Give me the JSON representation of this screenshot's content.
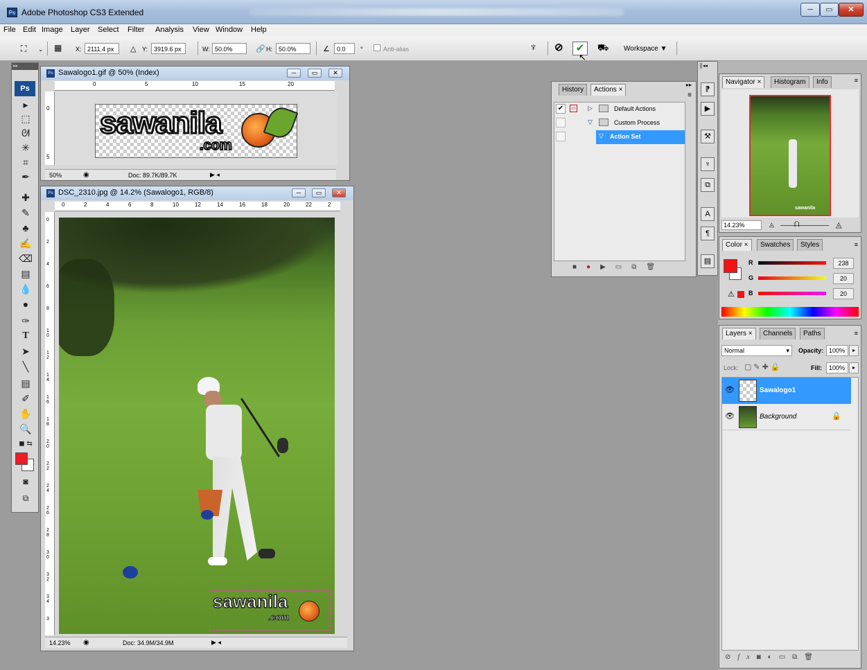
{
  "app": {
    "title": "Adobe Photoshop CS3 Extended",
    "icon_label": "Ps"
  },
  "menu": [
    "File",
    "Edit",
    "Image",
    "Layer",
    "Select",
    "Filter",
    "Analysis",
    "View",
    "Window",
    "Help"
  ],
  "options": {
    "x_label": "X:",
    "x_value": "2111.4 px",
    "y_label": "Y:",
    "y_value": "3919.6 px",
    "w_label": "W:",
    "w_value": "50.0%",
    "h_label": "H:",
    "h_value": "50.0%",
    "angle_value": "0.0",
    "angle_unit": "°",
    "antialias_label": "Anti-alias",
    "workspace_label": "Workspace ▼"
  },
  "toolbox": {
    "logo": "Ps",
    "tools": [
      "move-tool-icon",
      "marquee-tool-icon",
      "lasso-tool-icon",
      "magic-wand-icon",
      "crop-tool-icon",
      "slice-tool-icon",
      "healing-brush-icon",
      "brush-tool-icon",
      "clone-stamp-icon",
      "history-brush-icon",
      "eraser-icon",
      "gradient-icon",
      "blur-tool-icon",
      "dodge-tool-icon",
      "pen-tool-icon",
      "type-tool-icon",
      "path-select-icon",
      "line-tool-icon",
      "notes-tool-icon",
      "eyedropper-icon",
      "hand-tool-icon",
      "zoom-tool-icon"
    ],
    "fg_color": "#ec1c24",
    "bg_color": "#ffffff"
  },
  "doc1": {
    "title": "Sawalogo1.gif @ 50% (Index)",
    "ruler_h": [
      "0",
      "5",
      "10",
      "15",
      "20"
    ],
    "ruler_v": [
      "0",
      "5"
    ],
    "zoom": "50%",
    "doc_size": "Doc: 89.7K/89.7K",
    "logo_text": "sawanila",
    "logo_sub": ".com"
  },
  "doc2": {
    "title": "DSC_2310.jpg @ 14.2% (Sawalogo1, RGB/8)",
    "ruler_h": [
      "0",
      "2",
      "4",
      "6",
      "8",
      "10",
      "12",
      "14",
      "16",
      "18",
      "20",
      "22",
      "2"
    ],
    "ruler_v": [
      "0",
      "2",
      "4",
      "6",
      "8",
      "1 0",
      "1 2",
      "1 4",
      "1 6",
      "1 8",
      "2 0",
      "2 2",
      "2 4",
      "2 6",
      "2 8",
      "3 0",
      "3 2",
      "3 4",
      "3"
    ],
    "zoom": "14.23%",
    "doc_size": "Doc: 34.9M/34.9M",
    "watermark_text": "sawanila",
    "watermark_sub": ".com"
  },
  "actions_panel": {
    "tabs": [
      "History",
      "Actions ×"
    ],
    "rows": [
      {
        "name": "Default Actions",
        "checked": true
      },
      {
        "name": "Custom Process",
        "checked": false
      },
      {
        "name": "Action Set",
        "checked": false
      }
    ]
  },
  "navigator": {
    "tabs": [
      "Navigator ×",
      "Histogram",
      "Info"
    ],
    "zoom": "14.23%",
    "thumb_watermark": "sawanila"
  },
  "color_panel": {
    "tabs": [
      "Color ×",
      "Swatches",
      "Styles"
    ],
    "r_label": "R",
    "r_value": "238",
    "g_label": "G",
    "g_value": "20",
    "b_label": "B",
    "b_value": "20",
    "fg_color": "#ee1414"
  },
  "layers_panel": {
    "tabs": [
      "Layers ×",
      "Channels",
      "Paths"
    ],
    "blend_mode": "Normal",
    "opacity_label": "Opacity:",
    "opacity_value": "100%",
    "lock_label": "Lock:",
    "fill_label": "Fill:",
    "fill_value": "100%",
    "layers": [
      {
        "name": "Sawalogo1",
        "selected": true
      },
      {
        "name": "Background",
        "selected": false
      }
    ]
  }
}
